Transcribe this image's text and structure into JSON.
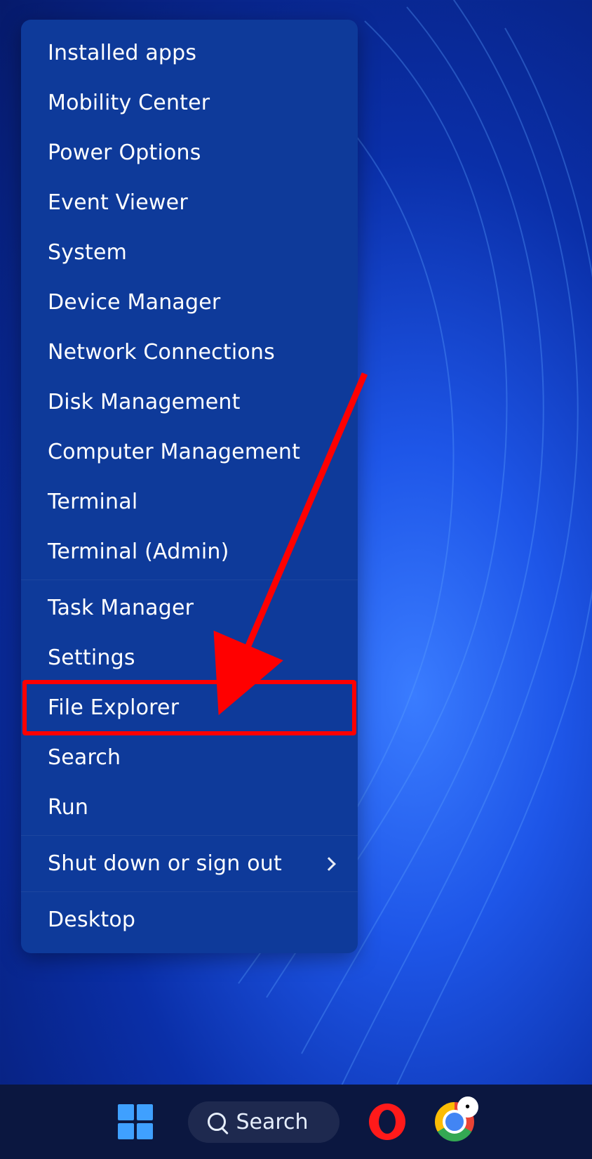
{
  "menu": {
    "items": [
      {
        "label": "Installed apps",
        "submenu": false,
        "sep_after": false,
        "highlighted": false
      },
      {
        "label": "Mobility Center",
        "submenu": false,
        "sep_after": false,
        "highlighted": false
      },
      {
        "label": "Power Options",
        "submenu": false,
        "sep_after": false,
        "highlighted": false
      },
      {
        "label": "Event Viewer",
        "submenu": false,
        "sep_after": false,
        "highlighted": false
      },
      {
        "label": "System",
        "submenu": false,
        "sep_after": false,
        "highlighted": false
      },
      {
        "label": "Device Manager",
        "submenu": false,
        "sep_after": false,
        "highlighted": false
      },
      {
        "label": "Network Connections",
        "submenu": false,
        "sep_after": false,
        "highlighted": false
      },
      {
        "label": "Disk Management",
        "submenu": false,
        "sep_after": false,
        "highlighted": false
      },
      {
        "label": "Computer Management",
        "submenu": false,
        "sep_after": false,
        "highlighted": false
      },
      {
        "label": "Terminal",
        "submenu": false,
        "sep_after": false,
        "highlighted": false
      },
      {
        "label": "Terminal (Admin)",
        "submenu": false,
        "sep_after": true,
        "highlighted": false
      },
      {
        "label": "Task Manager",
        "submenu": false,
        "sep_after": false,
        "highlighted": false
      },
      {
        "label": "Settings",
        "submenu": false,
        "sep_after": false,
        "highlighted": false
      },
      {
        "label": "File Explorer",
        "submenu": false,
        "sep_after": false,
        "highlighted": true
      },
      {
        "label": "Search",
        "submenu": false,
        "sep_after": false,
        "highlighted": false
      },
      {
        "label": "Run",
        "submenu": false,
        "sep_after": true,
        "highlighted": false
      },
      {
        "label": "Shut down or sign out",
        "submenu": true,
        "sep_after": true,
        "highlighted": false
      },
      {
        "label": "Desktop",
        "submenu": false,
        "sep_after": false,
        "highlighted": false
      }
    ]
  },
  "taskbar": {
    "search_label": "Search",
    "apps": [
      {
        "name": "start"
      },
      {
        "name": "search"
      },
      {
        "name": "opera"
      },
      {
        "name": "chrome"
      }
    ]
  },
  "annotation": {
    "highlight_color": "#ff0000",
    "arrow_color": "#ff0000"
  }
}
